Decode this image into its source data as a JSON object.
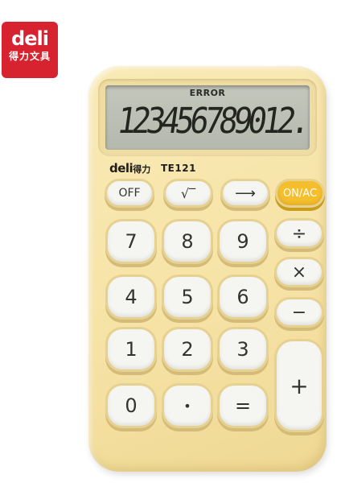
{
  "logo": {
    "text": "deli",
    "subtitle": "得力文具",
    "color": "#d7232f"
  },
  "calculator": {
    "body_color": "#f6e3a6",
    "display": {
      "indicator": "ERROR",
      "digits": "123456789012."
    },
    "brand": {
      "name": "deli",
      "name_cn": "得力",
      "model": "TE121"
    },
    "keys": {
      "off": "OFF",
      "sqrt": "√‾",
      "arrow": "⟶",
      "on_ac": "ON/AC",
      "k7": "7",
      "k8": "8",
      "k9": "9",
      "div": "÷",
      "mul": "×",
      "k4": "4",
      "k5": "5",
      "k6": "6",
      "minus": "−",
      "k1": "1",
      "k2": "2",
      "k3": "3",
      "plus": "+",
      "k0": "0",
      "dot": "•",
      "eq": "="
    },
    "accent_color": "#f5be2d"
  }
}
